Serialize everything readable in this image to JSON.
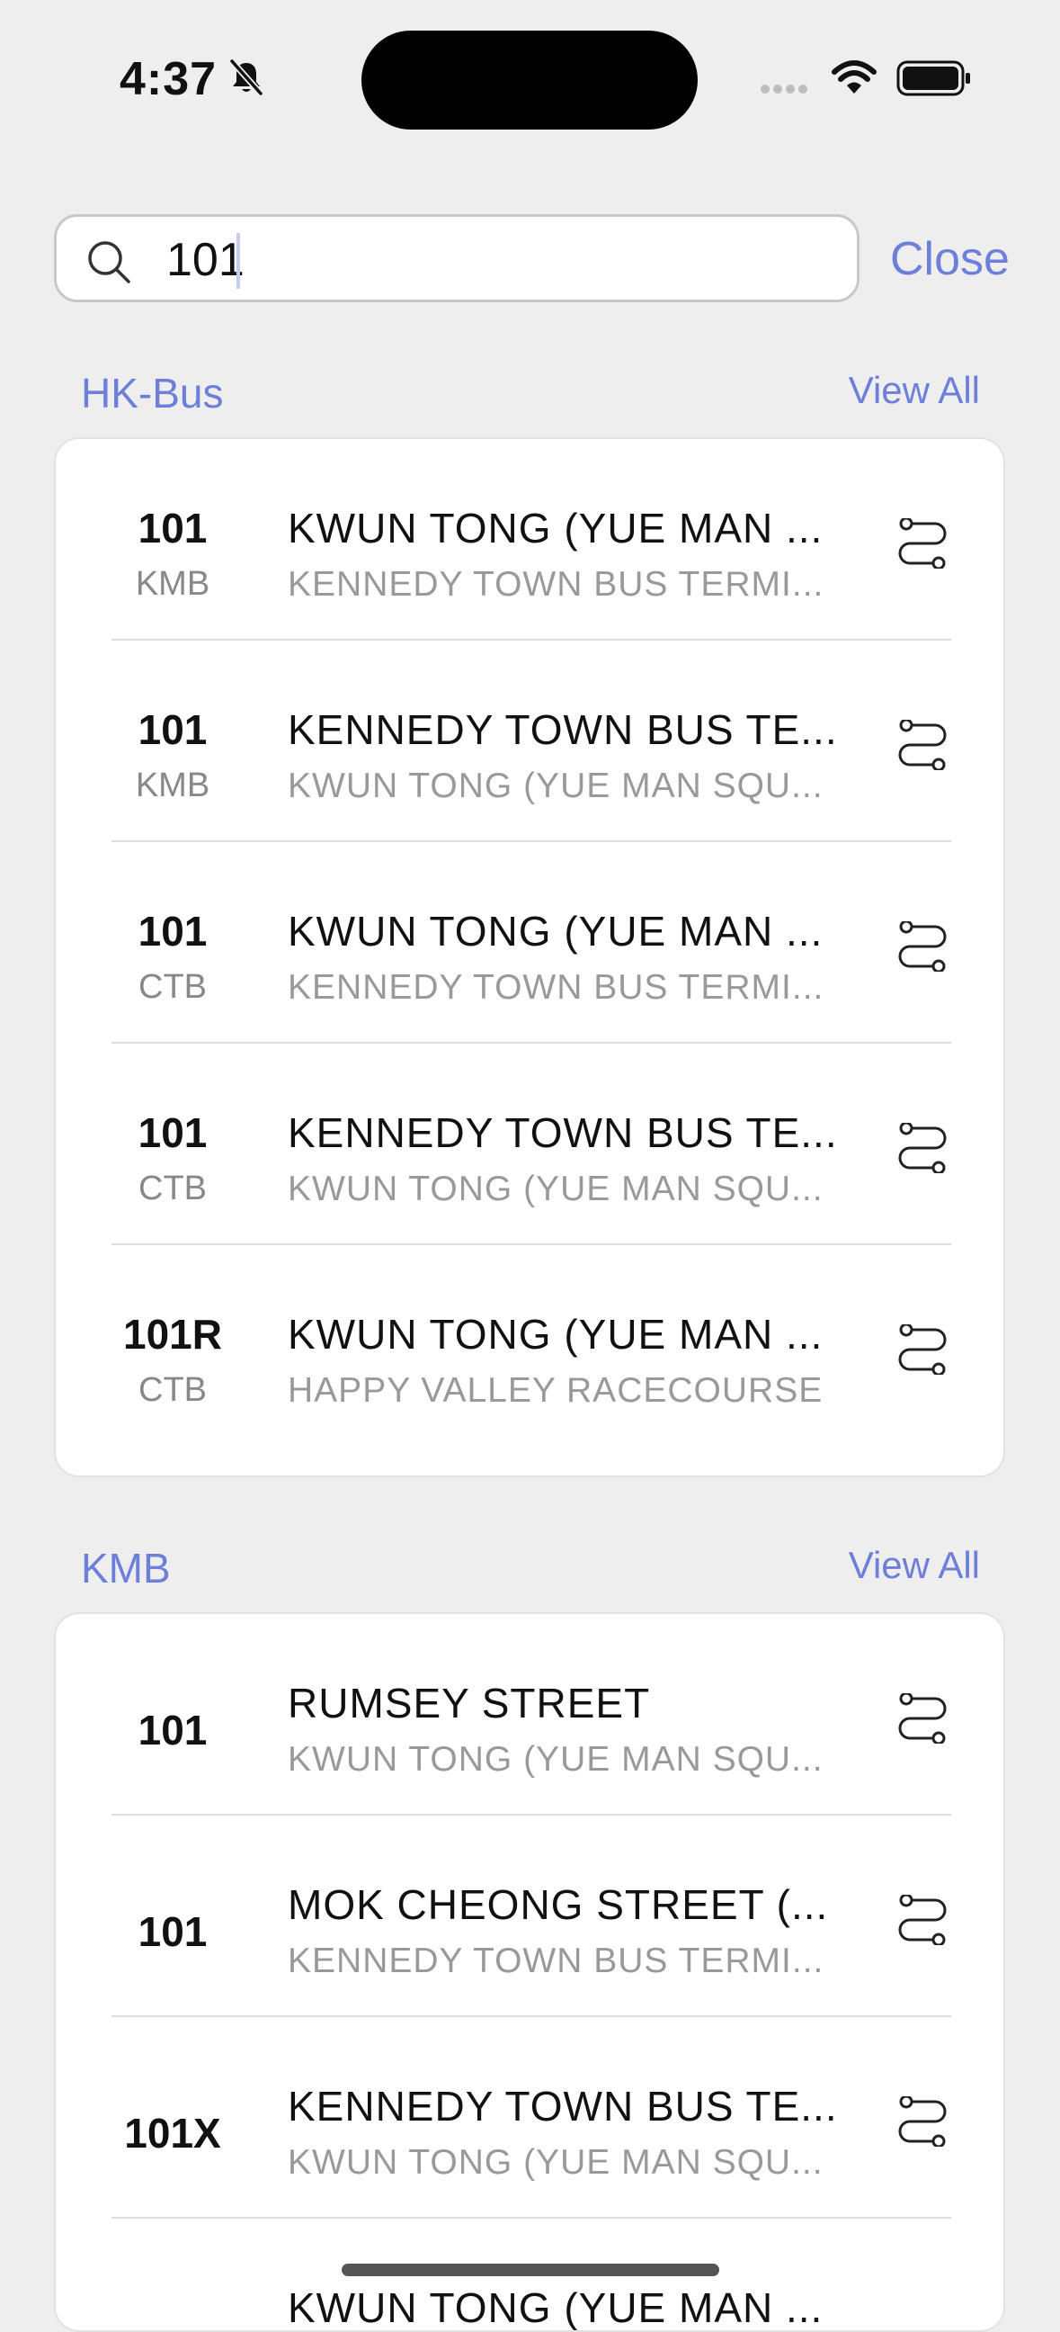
{
  "status_bar": {
    "time": "4:37"
  },
  "search": {
    "query": "101",
    "close_label": "Close"
  },
  "sections": {
    "hkbus": {
      "title": "HK-Bus",
      "view_all": "View All",
      "rows": [
        {
          "route": "101",
          "company": "KMB",
          "destination": "KWUN TONG (YUE MAN ...",
          "origin": "KENNEDY TOWN BUS TERMI..."
        },
        {
          "route": "101",
          "company": "KMB",
          "destination": "KENNEDY TOWN BUS TE...",
          "origin": "KWUN TONG (YUE MAN SQU..."
        },
        {
          "route": "101",
          "company": "CTB",
          "destination": "KWUN TONG (YUE MAN ...",
          "origin": "KENNEDY TOWN BUS TERMI..."
        },
        {
          "route": "101",
          "company": "CTB",
          "destination": "KENNEDY TOWN BUS TE...",
          "origin": "KWUN TONG (YUE MAN SQU..."
        },
        {
          "route": "101R",
          "company": "CTB",
          "destination": "KWUN TONG (YUE MAN ...",
          "origin": "HAPPY VALLEY RACECOURSE"
        }
      ]
    },
    "kmb": {
      "title": "KMB",
      "view_all": "View All",
      "rows": [
        {
          "route": "101",
          "destination": "RUMSEY STREET",
          "origin": "KWUN TONG (YUE MAN SQU..."
        },
        {
          "route": "101",
          "destination": "MOK CHEONG STREET (...",
          "origin": "KENNEDY TOWN BUS TERMI..."
        },
        {
          "route": "101X",
          "destination": "KENNEDY TOWN BUS TE...",
          "origin": "KWUN TONG (YUE MAN SQU..."
        },
        {
          "route": "",
          "destination": "KWUN TONG (YUE MAN ...",
          "origin": ""
        }
      ]
    }
  },
  "colors": {
    "accent": "#6D7FD9",
    "background": "#EEEEEE"
  }
}
